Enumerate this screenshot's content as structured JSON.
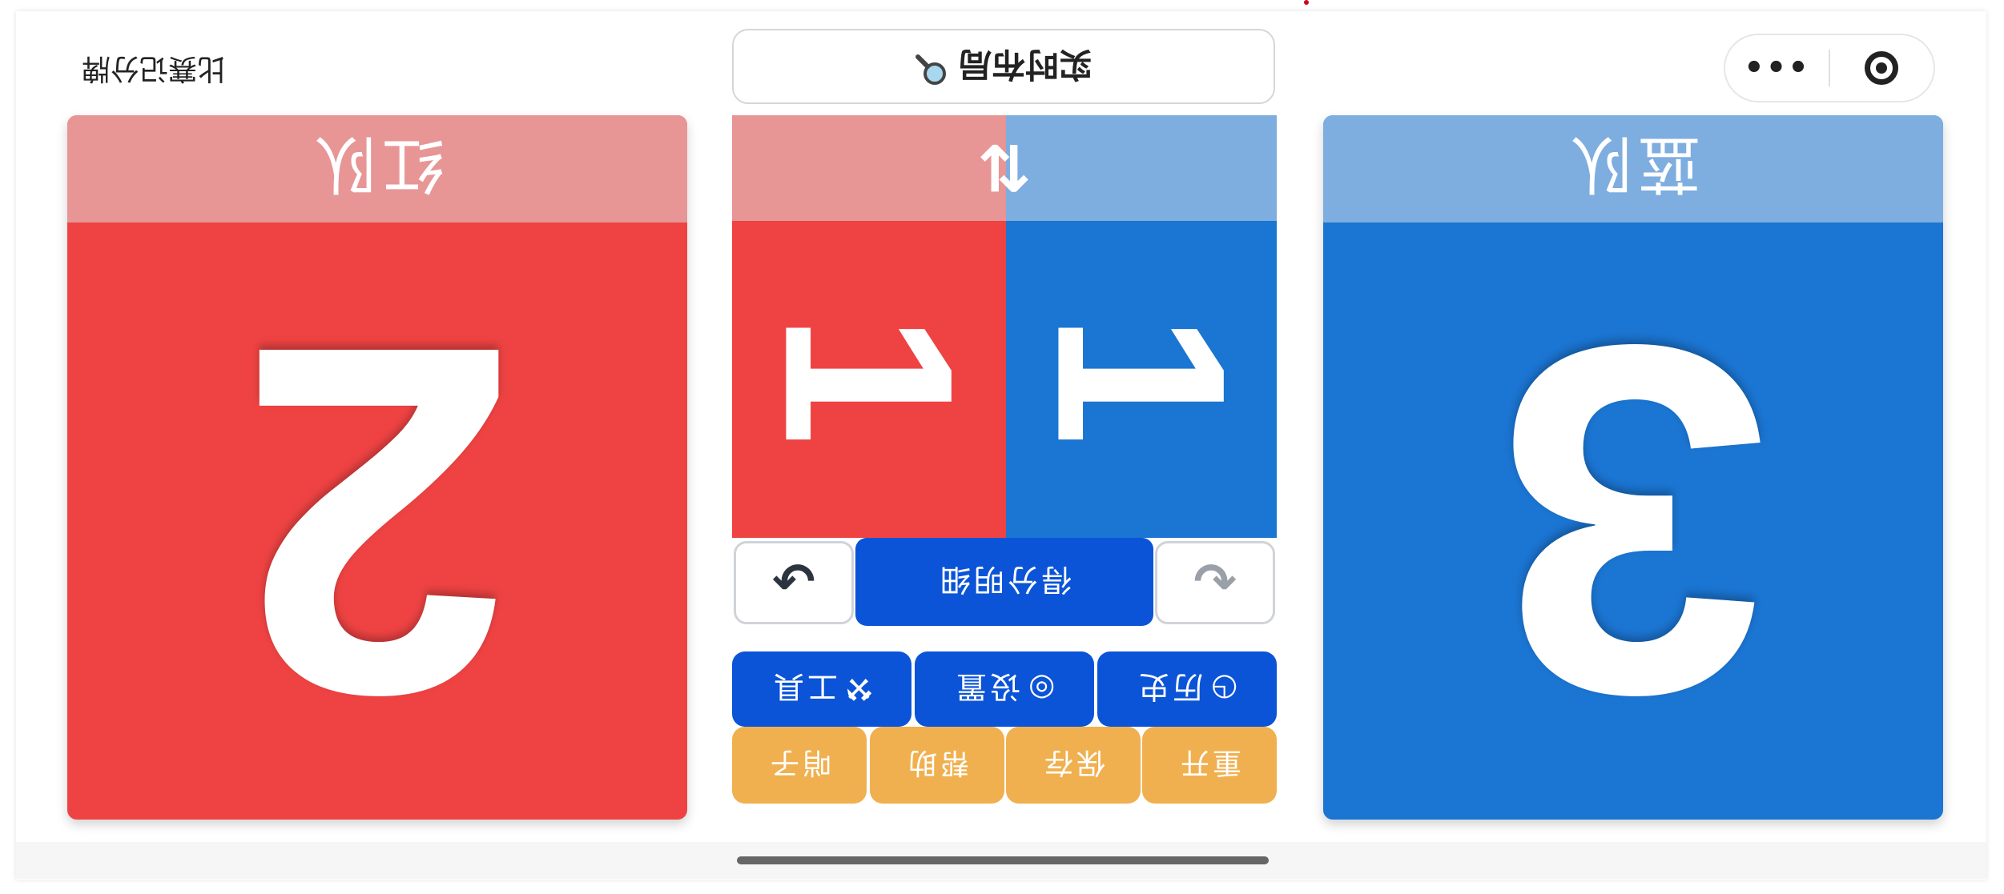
{
  "header": {
    "app_title": "比赛记分牌",
    "layout_button_label": "实时布局",
    "layout_button_icon": "magnifier-icon",
    "capsule_more": "•••"
  },
  "red_team": {
    "name": "红队",
    "score": "2",
    "sets": "1",
    "color": "#ef4343",
    "header_color": "#e89596"
  },
  "blue_team": {
    "name": "蓝队",
    "score": "3",
    "sets": "1",
    "color": "#1b75d2",
    "header_color": "#7eaddf"
  },
  "swap_icon": "⇅",
  "controls": {
    "undo_icon": "↶",
    "redo_icon": "↷",
    "detail_label": "得分明细"
  },
  "tools": [
    {
      "label": "历史",
      "icon": "history-icon",
      "glyph": "◷"
    },
    {
      "label": "设置",
      "icon": "gear-icon",
      "glyph": "◎"
    },
    {
      "label": "工具",
      "icon": "wrench-icon",
      "glyph": "⚒"
    }
  ],
  "small_actions": [
    {
      "label": "重开"
    },
    {
      "label": "保存"
    },
    {
      "label": "帮助"
    },
    {
      "label": "哨子"
    }
  ],
  "colors": {
    "primary_button": "#0b54d8",
    "secondary_button": "#f0b04f"
  }
}
